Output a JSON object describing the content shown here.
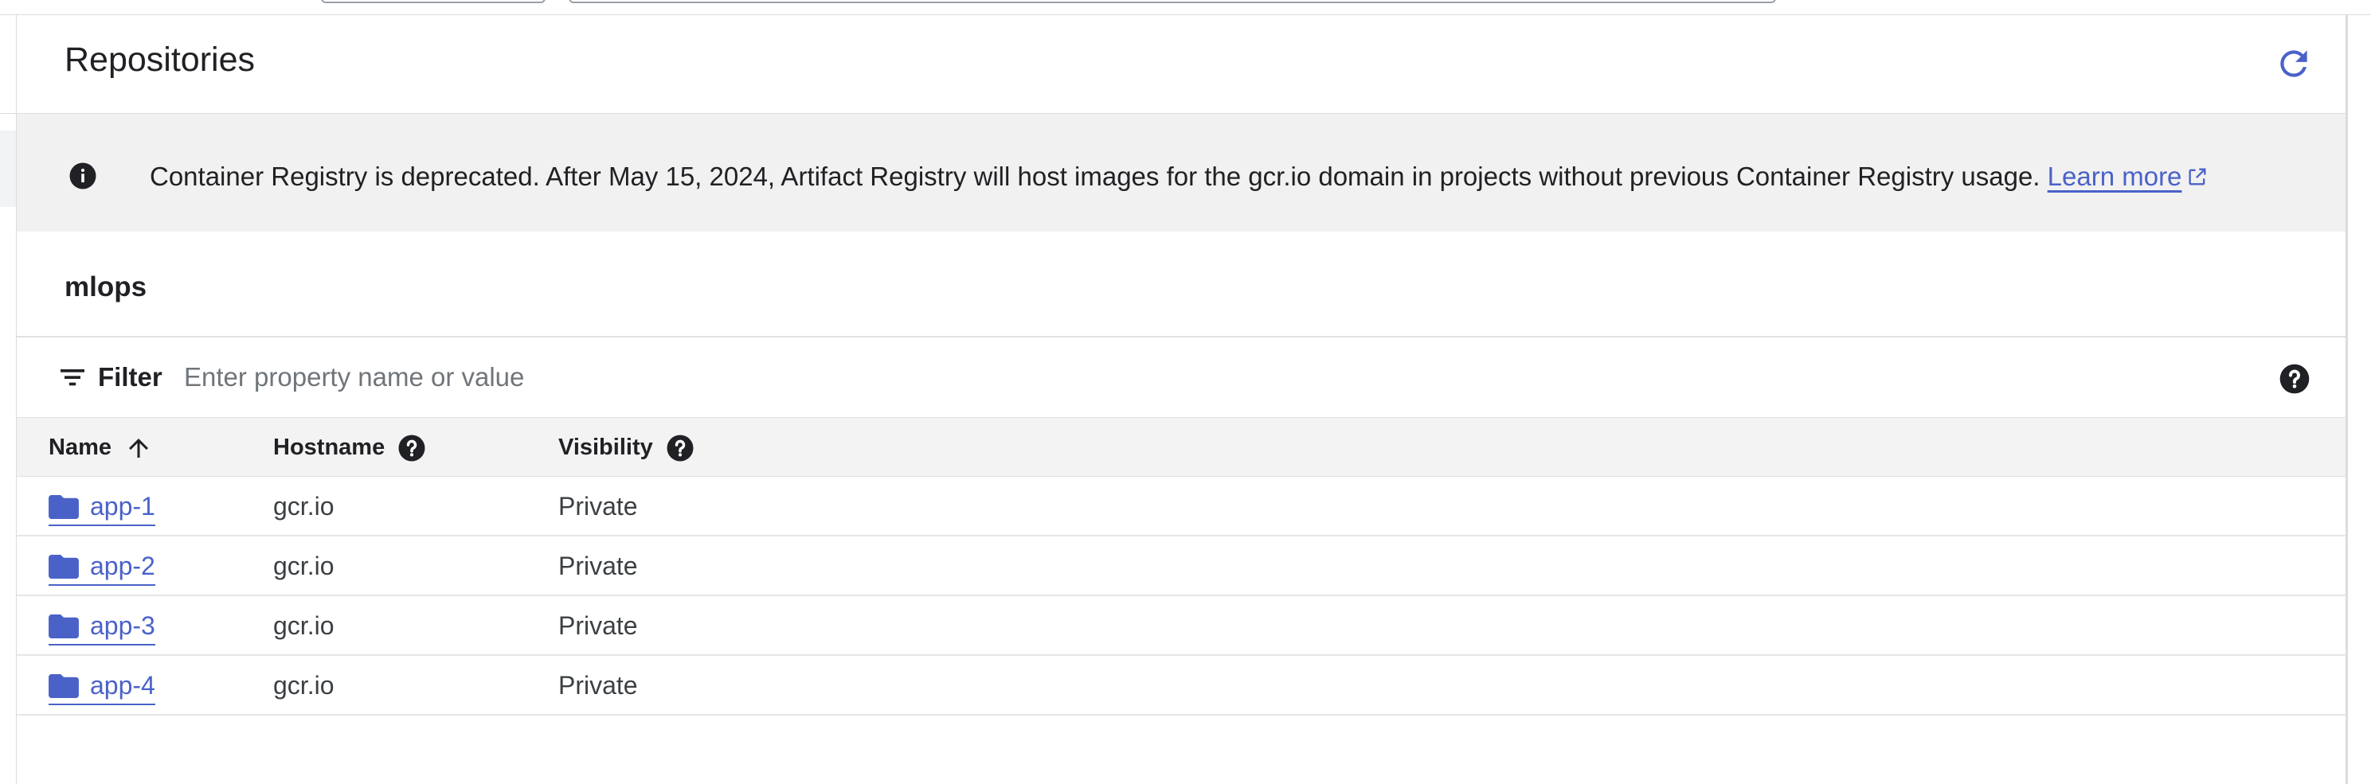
{
  "header": {
    "title": "Repositories",
    "refresh_icon": "refresh-icon"
  },
  "banner": {
    "icon": "info-icon",
    "message": "Container Registry is deprecated. After May 15, 2024, Artifact Registry will host images for the gcr.io domain in projects without previous Container Registry usage.",
    "link_label": "Learn more",
    "link_icon": "open-in-new-icon"
  },
  "project": {
    "name": "mlops"
  },
  "filter": {
    "label": "Filter",
    "placeholder": "Enter property name or value",
    "value": ""
  },
  "table": {
    "columns": [
      {
        "label": "Name",
        "sort": "ascending"
      },
      {
        "label": "Hostname",
        "help": true
      },
      {
        "label": "Visibility",
        "help": true
      }
    ],
    "rows": [
      {
        "name": "app-1",
        "hostname": "gcr.io",
        "visibility": "Private"
      },
      {
        "name": "app-2",
        "hostname": "gcr.io",
        "visibility": "Private"
      },
      {
        "name": "app-3",
        "hostname": "gcr.io",
        "visibility": "Private"
      },
      {
        "name": "app-4",
        "hostname": "gcr.io",
        "visibility": "Private"
      }
    ]
  },
  "colors": {
    "accent": "#4a62c8",
    "banner_bg": "#f1f1f1",
    "header_bg": "#f3f3f3",
    "text": "#202124"
  }
}
